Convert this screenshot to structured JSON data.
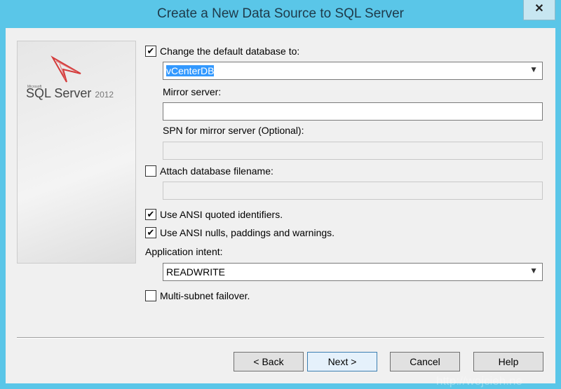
{
  "window": {
    "title": "Create a New Data Source to SQL Server",
    "close": "✕"
  },
  "logo": {
    "brand": "Microsoft",
    "product": "SQL Server",
    "year": "2012"
  },
  "form": {
    "change_db": {
      "label": "Change the default database to:",
      "checked": true,
      "value": "vCenterDB"
    },
    "mirror": {
      "label": "Mirror server:",
      "value": ""
    },
    "spn": {
      "label": "SPN for mirror server (Optional):",
      "value": ""
    },
    "attach": {
      "label": "Attach database filename:",
      "checked": false,
      "value": ""
    },
    "ansi_quoted": {
      "label": "Use ANSI quoted identifiers.",
      "checked": true
    },
    "ansi_nulls": {
      "label": "Use ANSI nulls, paddings and warnings.",
      "checked": true
    },
    "intent": {
      "label": "Application intent:",
      "value": "READWRITE"
    },
    "multisubnet": {
      "label": "Multi-subnet failover.",
      "checked": false
    }
  },
  "buttons": {
    "back": "< Back",
    "next": "Next >",
    "cancel": "Cancel",
    "help": "Help"
  },
  "watermark": "http://wojcieh.ne"
}
